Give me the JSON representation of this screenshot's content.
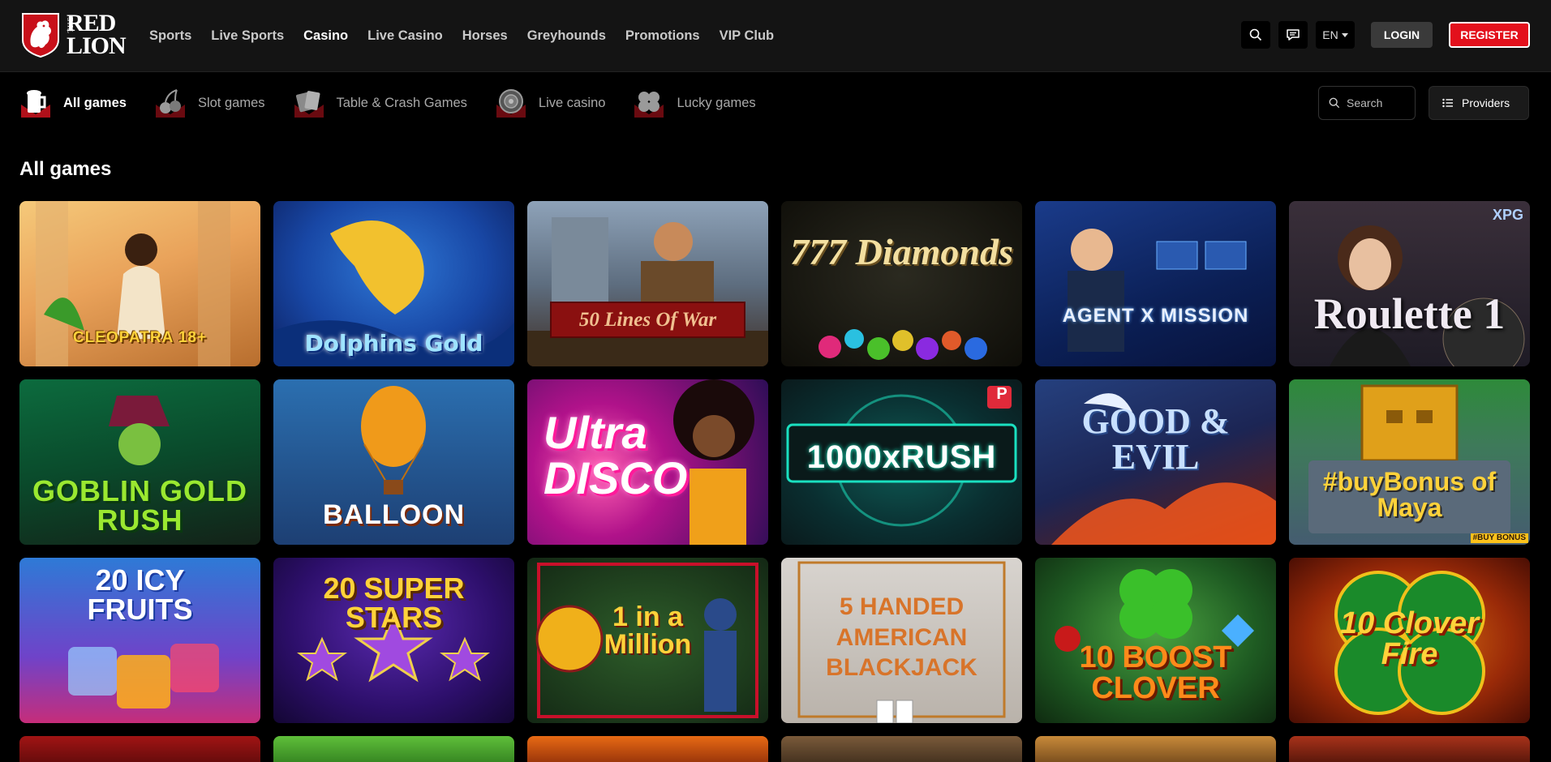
{
  "brand": {
    "the": "THE",
    "line1": "RED",
    "line2": "LION"
  },
  "nav": [
    {
      "label": "Sports",
      "active": false
    },
    {
      "label": "Live Sports",
      "active": false
    },
    {
      "label": "Casino",
      "active": true
    },
    {
      "label": "Live Casino",
      "active": false
    },
    {
      "label": "Horses",
      "active": false
    },
    {
      "label": "Greyhounds",
      "active": false
    },
    {
      "label": "Promotions",
      "active": false
    },
    {
      "label": "VIP Club",
      "active": false
    }
  ],
  "header": {
    "lang": "EN",
    "login": "LOGIN",
    "register": "REGISTER"
  },
  "categories": [
    {
      "label": "All games",
      "active": true,
      "icon": "beer-mug-icon"
    },
    {
      "label": "Slot games",
      "active": false,
      "icon": "cherries-icon"
    },
    {
      "label": "Table & Crash Games",
      "active": false,
      "icon": "playing-cards-icon"
    },
    {
      "label": "Live casino",
      "active": false,
      "icon": "roulette-wheel-icon"
    },
    {
      "label": "Lucky games",
      "active": false,
      "icon": "clover-icon"
    }
  ],
  "search": {
    "placeholder": "Search"
  },
  "providers_label": "Providers",
  "section_title": "All games",
  "games": [
    {
      "title": "CLEOPATRA 18+"
    },
    {
      "title": "Dolphins Gold"
    },
    {
      "title": "50 Lines Of War"
    },
    {
      "title": "777 Diamonds"
    },
    {
      "title": "AGENT X MISSION"
    },
    {
      "title": "Roulette 1",
      "badge": "XPG"
    },
    {
      "title": "GOBLIN GOLD RUSH"
    },
    {
      "title": "BALLOON"
    },
    {
      "title": "Ultra DISCO"
    },
    {
      "title": "1000xRUSH",
      "badge": "P"
    },
    {
      "title": "GOOD & EVIL"
    },
    {
      "title": "#buyBonus of Maya",
      "badge": "#BUY BONUS"
    },
    {
      "title": "20 ICY FRUITS"
    },
    {
      "title": "20 SUPER STARS"
    },
    {
      "title": "1 in a Million"
    },
    {
      "title": "5 HANDED AMERICAN BLACKJACK"
    },
    {
      "title": "10 BOOST CLOVER"
    },
    {
      "title": "10 Clover Fire"
    }
  ],
  "colors": {
    "accent": "#e3101c",
    "bg": "#000000",
    "header": "#141414"
  }
}
